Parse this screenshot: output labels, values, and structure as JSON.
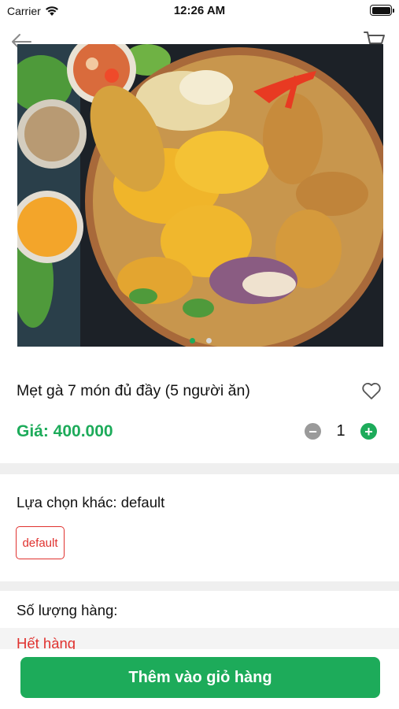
{
  "status_bar": {
    "carrier": "Carrier",
    "time": "12:26 AM"
  },
  "icons": {
    "back": "arrow-left-icon",
    "cart": "cart-icon",
    "wifi": "wifi-icon",
    "battery": "battery-icon",
    "favorite": "heart-outline-icon",
    "minus": "minus-circle-icon",
    "plus": "plus-circle-icon"
  },
  "carousel": {
    "slide_count": 2,
    "active_index": 0
  },
  "product": {
    "name": "Mẹt gà 7 món đủ đầy (5 người ăn)",
    "price": "Giá: 400.000",
    "quantity": "1",
    "minus_label": "−",
    "plus_label": "+"
  },
  "options": {
    "label": "Lựa chọn khác: default",
    "items": [
      "default"
    ]
  },
  "stock": {
    "label": "Số lượng hàng:",
    "status": "Hết hàng"
  },
  "actions": {
    "add_to_cart": "Thêm vào giỏ hàng"
  },
  "colors": {
    "accent": "#1dab5a",
    "danger": "#e0322f",
    "muted": "#9a9a9a"
  }
}
